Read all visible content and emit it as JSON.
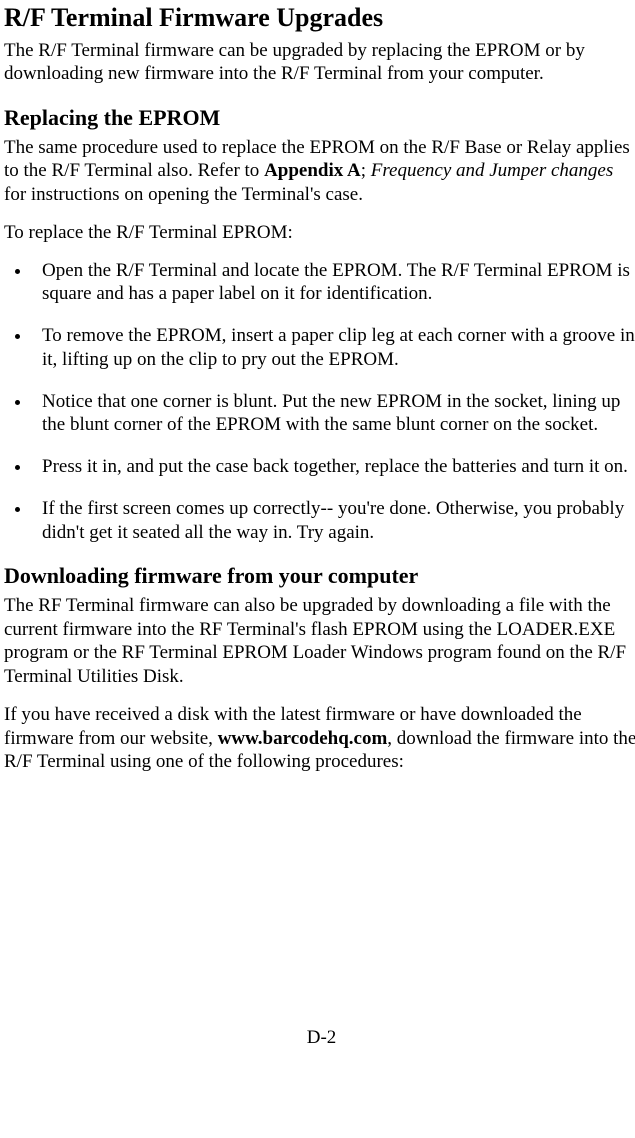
{
  "title": "R/F Terminal Firmware Upgrades",
  "intro": "The R/F Terminal firmware can be upgraded by replacing the EPROM or by downloading new firmware into the R/F Terminal from your computer.",
  "section1": {
    "heading": "Replacing the EPROM",
    "para1_pre": "The same procedure used to replace the EPROM on the R/F Base or Relay applies to the R/F Terminal also. Refer to ",
    "para1_bold": "Appendix A",
    "para1_sep": "; ",
    "para1_italic": "Frequency and Jumper changes",
    "para1_post": " for instructions on opening the Terminal's case.",
    "para2": "To replace the R/F Terminal EPROM:",
    "bullets": [
      "Open the R/F Terminal and locate the EPROM. The R/F Terminal EPROM is square and has a paper label on it for identification.",
      "To remove the EPROM, insert a paper clip leg at each corner with a groove in it, lifting up on the clip to pry out the EPROM.",
      "Notice that one corner is blunt.  Put the new EPROM in the socket, lining up the blunt corner of the EPROM with the same blunt corner on the socket.",
      "Press it in, and put the case back together, replace the batteries and turn it on.",
      "If the first screen comes up correctly-- you're done.  Otherwise, you probably didn't get it seated all the way in. Try again."
    ]
  },
  "section2": {
    "heading": "Downloading firmware from your computer",
    "para1": "The RF Terminal firmware can also be upgraded by downloading a file with the current firmware into the RF Terminal's flash EPROM using the LOADER.EXE program or the RF Terminal EPROM Loader Windows program found on the R/F Terminal Utilities Disk.",
    "para2_pre": "If you have received a disk with the latest firmware or have downloaded the firmware from our website, ",
    "para2_bold": "www.barcodehq.com",
    "para2_post": ", download the firmware into the R/F Terminal using one of the following procedures:"
  },
  "page_number": "D-2"
}
